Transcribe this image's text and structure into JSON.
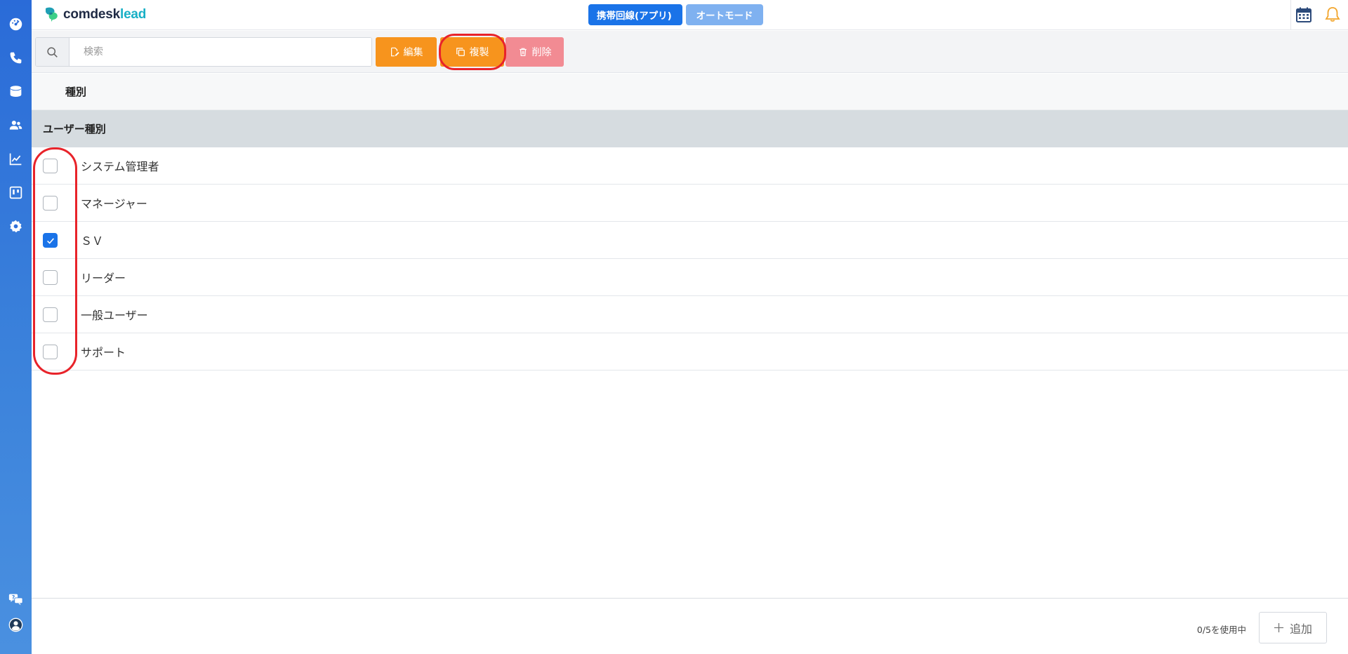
{
  "header": {
    "logo_prefix": "comdesk",
    "logo_suffix": "lead",
    "mode_app_label": "携帯回線(アプリ)",
    "mode_auto_label": "オートモード"
  },
  "toolbar": {
    "search_placeholder": "検索",
    "edit_label": "編集",
    "copy_label": "複製",
    "delete_label": "削除"
  },
  "table": {
    "column_header": "種別",
    "group_header": "ユーザー種別",
    "rows": [
      {
        "label": "システム管理者",
        "checked": false
      },
      {
        "label": "マネージャー",
        "checked": false
      },
      {
        "label": "ＳＶ",
        "checked": true
      },
      {
        "label": "リーダー",
        "checked": false
      },
      {
        "label": "一般ユーザー",
        "checked": false
      },
      {
        "label": "サポート",
        "checked": false
      }
    ]
  },
  "footer": {
    "usage_text": "0/5を使用中",
    "add_label": "追加"
  },
  "colors": {
    "sidebar": "#2a6bd8",
    "primary": "#1a73e8",
    "orange": "#f7941d",
    "delete": "#f28b93",
    "annotation": "#e8232a"
  }
}
